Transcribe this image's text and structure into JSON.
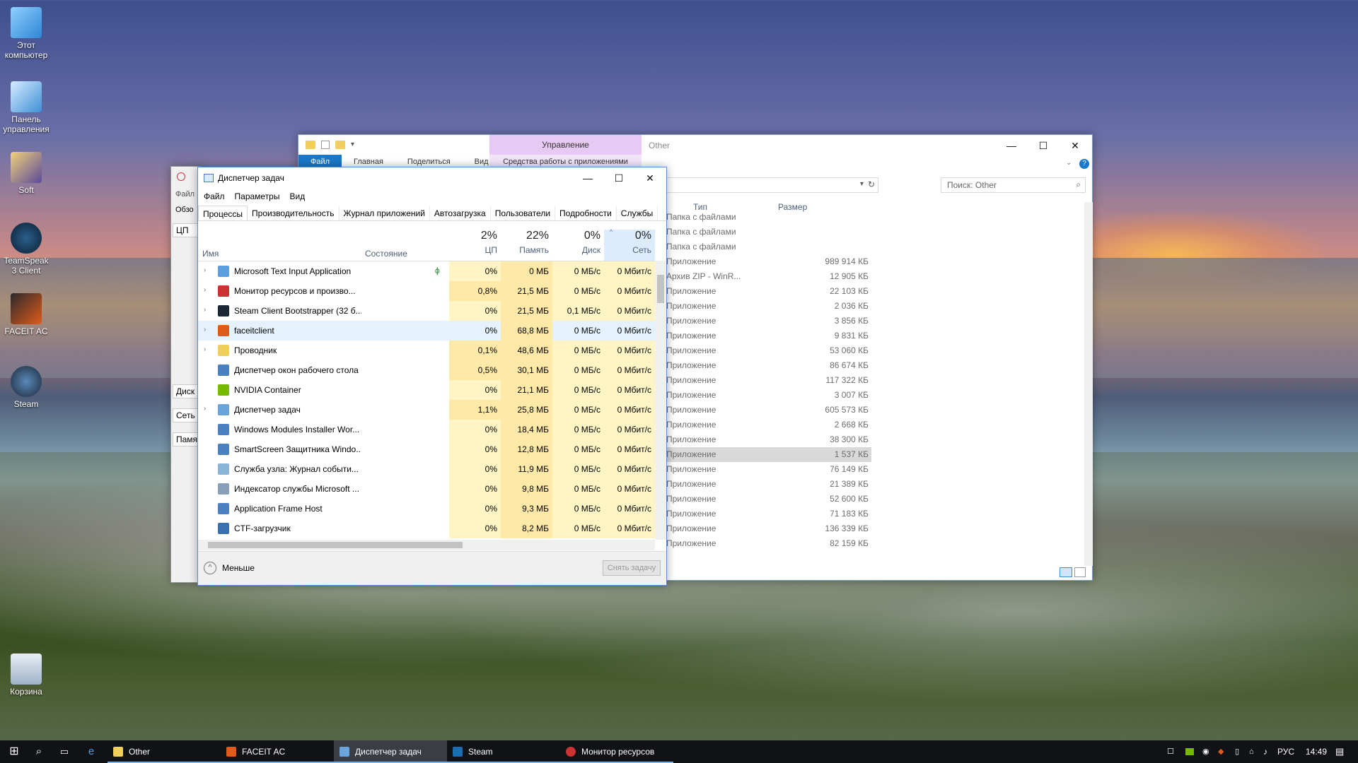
{
  "desktop": {
    "icons": [
      {
        "label": "Этот компьютер"
      },
      {
        "label": "Панель управления"
      },
      {
        "label": "Soft"
      },
      {
        "label": "TeamSpeak 3 Client"
      },
      {
        "label": "FACEIT AC"
      },
      {
        "label": "Steam"
      },
      {
        "label": "Корзина"
      }
    ]
  },
  "explorer": {
    "title": "Other",
    "ribbon_context_title": "Управление",
    "ribbon_context_tab": "Средства работы с приложениями",
    "tabs": [
      "Файл",
      "Главная",
      "Поделиться",
      "Вид"
    ],
    "search_placeholder": "Поиск: Other",
    "col_type": "Тип",
    "col_size": "Размер",
    "rows": [
      {
        "type": "Папка с файлами",
        "size": ""
      },
      {
        "type": "Папка с файлами",
        "size": ""
      },
      {
        "type": "Папка с файлами",
        "size": ""
      },
      {
        "type": "Приложение",
        "size": "989 914 КБ"
      },
      {
        "type": "Архив ZIP - WinR...",
        "size": "12 905 КБ"
      },
      {
        "type": "Приложение",
        "size": "22 103 КБ"
      },
      {
        "type": "Приложение",
        "size": "2 036 КБ"
      },
      {
        "type": "Приложение",
        "size": "3 856 КБ"
      },
      {
        "type": "Приложение",
        "size": "9 831 КБ"
      },
      {
        "type": "Приложение",
        "size": "53 060 КБ"
      },
      {
        "type": "Приложение",
        "size": "86 674 КБ"
      },
      {
        "type": "Приложение",
        "size": "117 322 КБ"
      },
      {
        "type": "Приложение",
        "size": "3 007 КБ"
      },
      {
        "type": "Приложение",
        "size": "605 573 КБ"
      },
      {
        "type": "Приложение",
        "size": "2 668 КБ"
      },
      {
        "type": "Приложение",
        "size": "38 300 КБ"
      },
      {
        "type": "Приложение",
        "size": "1 537 КБ"
      },
      {
        "type": "Приложение",
        "size": "76 149 КБ"
      },
      {
        "type": "Приложение",
        "size": "21 389 КБ"
      },
      {
        "type": "Приложение",
        "size": "52 600 КБ"
      },
      {
        "type": "Приложение",
        "size": "71 183 КБ"
      },
      {
        "type": "Приложение",
        "size": "136 339 КБ"
      },
      {
        "type": "Приложение",
        "size": "82 159 КБ"
      }
    ]
  },
  "resmon": {
    "menu_first": "Файл",
    "tab_first": "Обзо",
    "sections": [
      "ЦП",
      "Диск",
      "Сеть",
      "Памя"
    ]
  },
  "taskmgr": {
    "title": "Диспетчер задач",
    "menu": [
      "Файл",
      "Параметры",
      "Вид"
    ],
    "tabs": [
      "Процессы",
      "Производительность",
      "Журнал приложений",
      "Автозагрузка",
      "Пользователи",
      "Подробности",
      "Службы"
    ],
    "headers": {
      "name": "Имя",
      "status": "Состояние",
      "cpu_pct": "2%",
      "cpu_lbl": "ЦП",
      "mem_pct": "22%",
      "mem_lbl": "Память",
      "disk_pct": "0%",
      "disk_lbl": "Диск",
      "net_pct": "0%",
      "net_lbl": "Сеть"
    },
    "rows": [
      {
        "name": "Microsoft Text Input Application",
        "cpu": "0%",
        "mem": "0 МБ",
        "disk": "0 МБ/с",
        "net": "0 Мбит/с",
        "icon_color": "#5aa0e0"
      },
      {
        "name": "Монитор ресурсов и произво...",
        "cpu": "0,8%",
        "mem": "21,5 МБ",
        "disk": "0 МБ/с",
        "net": "0 Мбит/с",
        "icon_color": "#c33"
      },
      {
        "name": "Steam Client Bootstrapper (32 б...",
        "cpu": "0%",
        "mem": "21,5 МБ",
        "disk": "0,1 МБ/с",
        "net": "0 Мбит/с",
        "icon_color": "#1b2838"
      },
      {
        "name": "faceitclient",
        "cpu": "0%",
        "mem": "68,8 МБ",
        "disk": "0 МБ/с",
        "net": "0 Мбит/с",
        "icon_color": "#e05a1b"
      },
      {
        "name": "Проводник",
        "cpu": "0,1%",
        "mem": "48,6 МБ",
        "disk": "0 МБ/с",
        "net": "0 Мбит/с",
        "icon_color": "#f2cf5b"
      },
      {
        "name": "Диспетчер окон рабочего стола",
        "cpu": "0,5%",
        "mem": "30,1 МБ",
        "disk": "0 МБ/с",
        "net": "0 Мбит/с",
        "icon_color": "#4a7fc1"
      },
      {
        "name": "NVIDIA Container",
        "cpu": "0%",
        "mem": "21,1 МБ",
        "disk": "0 МБ/с",
        "net": "0 Мбит/с",
        "icon_color": "#76b900"
      },
      {
        "name": "Диспетчер задач",
        "cpu": "1,1%",
        "mem": "25,8 МБ",
        "disk": "0 МБ/с",
        "net": "0 Мбит/с",
        "icon_color": "#6aa4d8"
      },
      {
        "name": "Windows Modules Installer Wor...",
        "cpu": "0%",
        "mem": "18,4 МБ",
        "disk": "0 МБ/с",
        "net": "0 Мбит/с",
        "icon_color": "#4a7fc1"
      },
      {
        "name": "SmartScreen Защитника Windo...",
        "cpu": "0%",
        "mem": "12,8 МБ",
        "disk": "0 МБ/с",
        "net": "0 Мбит/с",
        "icon_color": "#4a7fc1"
      },
      {
        "name": "Служба узла: Журнал событи...",
        "cpu": "0%",
        "mem": "11,9 МБ",
        "disk": "0 МБ/с",
        "net": "0 Мбит/с",
        "icon_color": "#8ab4d8"
      },
      {
        "name": "Индексатор службы Microsoft ...",
        "cpu": "0%",
        "mem": "9,8 МБ",
        "disk": "0 МБ/с",
        "net": "0 Мбит/с",
        "icon_color": "#8aa0b8"
      },
      {
        "name": "Application Frame Host",
        "cpu": "0%",
        "mem": "9,3 МБ",
        "disk": "0 МБ/с",
        "net": "0 Мбит/с",
        "icon_color": "#4a7fc1"
      },
      {
        "name": "CTF-загрузчик",
        "cpu": "0%",
        "mem": "8,2 МБ",
        "disk": "0 МБ/с",
        "net": "0 Мбит/с",
        "icon_color": "#3a6fb0"
      }
    ],
    "less_label": "Меньше",
    "end_task_label": "Снять задачу"
  },
  "taskbar": {
    "apps": [
      {
        "label": "Other",
        "color": "#f2cf5b"
      },
      {
        "label": "FACEIT AC",
        "color": "#e05a1b"
      },
      {
        "label": "Диспетчер задач",
        "color": "#6aa4d8"
      },
      {
        "label": "Steam",
        "color": "#1b6fb0"
      },
      {
        "label": "Монитор ресурсов",
        "color": "#c33"
      }
    ],
    "lang": "РУС",
    "time": "14:49"
  }
}
